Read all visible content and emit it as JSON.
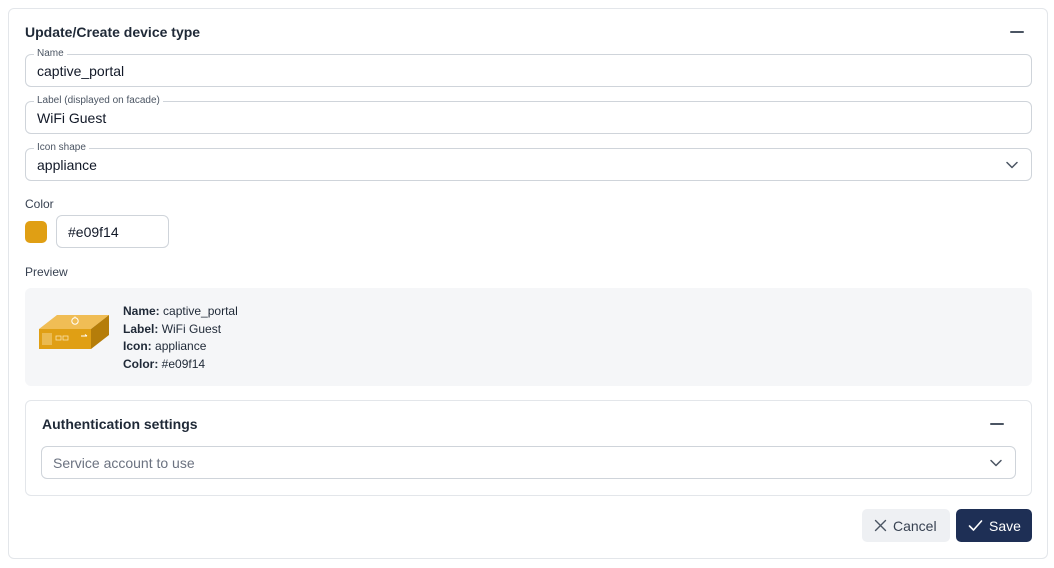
{
  "panel": {
    "title": "Update/Create device type"
  },
  "fields": {
    "name": {
      "legend": "Name",
      "value": "captive_portal"
    },
    "label": {
      "legend": "Label (displayed on facade)",
      "value": "WiFi Guest"
    },
    "icon_shape": {
      "legend": "Icon shape",
      "value": "appliance"
    }
  },
  "color": {
    "label": "Color",
    "value": "#e09f14",
    "swatch_color": "#e09f14"
  },
  "preview": {
    "label": "Preview",
    "icon": "appliance-icon",
    "lines": {
      "name_key": "Name:",
      "name_val": "captive_portal",
      "label_key": "Label:",
      "label_val": "WiFi Guest",
      "icon_key": "Icon:",
      "icon_val": "appliance",
      "color_key": "Color:",
      "color_val": "#e09f14"
    }
  },
  "auth": {
    "title": "Authentication settings",
    "service_account_placeholder": "Service account to use"
  },
  "buttons": {
    "cancel": "Cancel",
    "save": "Save"
  },
  "colors": {
    "accent": "#1e2f55",
    "swatch": "#e09f14"
  }
}
